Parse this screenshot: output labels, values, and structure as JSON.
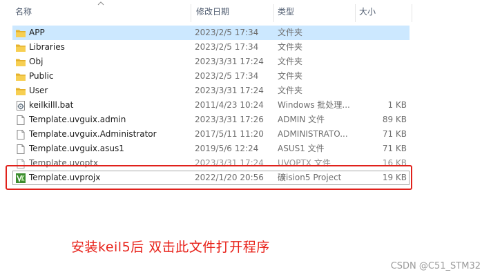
{
  "header": {
    "name": "名称",
    "date": "修改日期",
    "type": "类型",
    "size": "大小"
  },
  "rows": [
    {
      "name": "APP",
      "date": "2023/2/5 17:34",
      "type": "文件夹",
      "size": "",
      "icon": "folder-icon",
      "selected": true
    },
    {
      "name": "Libraries",
      "date": "2023/2/5 17:34",
      "type": "文件夹",
      "size": "",
      "icon": "folder-icon"
    },
    {
      "name": "Obj",
      "date": "2023/3/31 17:24",
      "type": "文件夹",
      "size": "",
      "icon": "folder-icon"
    },
    {
      "name": "Public",
      "date": "2023/2/5 17:34",
      "type": "文件夹",
      "size": "",
      "icon": "folder-icon"
    },
    {
      "name": "User",
      "date": "2023/3/31 17:24",
      "type": "文件夹",
      "size": "",
      "icon": "folder-icon"
    },
    {
      "name": "keilkilll.bat",
      "date": "2011/4/23 10:24",
      "type": "Windows 批处理...",
      "size": "1 KB",
      "icon": "batch-file-icon"
    },
    {
      "name": "Template.uvguix.admin",
      "date": "2023/3/31 17:26",
      "type": "ADMIN 文件",
      "size": "89 KB",
      "icon": "file-icon"
    },
    {
      "name": "Template.uvguix.Administrator",
      "date": "2017/5/11 11:20",
      "type": "ADMINISTRATO...",
      "size": "71 KB",
      "icon": "file-icon"
    },
    {
      "name": "Template.uvguix.asus1",
      "date": "2019/5/6 12:24",
      "type": "ASUS1 文件",
      "size": "71 KB",
      "icon": "file-icon"
    },
    {
      "name": "Template.uvoptx",
      "date": "2023/3/31 17:24",
      "type": "UVOPTX 文件",
      "size": "16 KB",
      "icon": "file-icon"
    },
    {
      "name": "Template.uvprojx",
      "date": "2022/1/20 20:56",
      "type": "礦ision5 Project",
      "size": "19 KB",
      "icon": "keil-project-icon",
      "focused": true
    }
  ],
  "annotation": "安装keil5后  双击此文件打开程序",
  "watermark": "CSDN @C51_STM32",
  "colors": {
    "selected_bg": "#cce8ff",
    "highlight_border": "#e0211b",
    "annotation_text": "#e8221a",
    "folder": "#f5c542",
    "keil_green": "#3c8d2f"
  }
}
